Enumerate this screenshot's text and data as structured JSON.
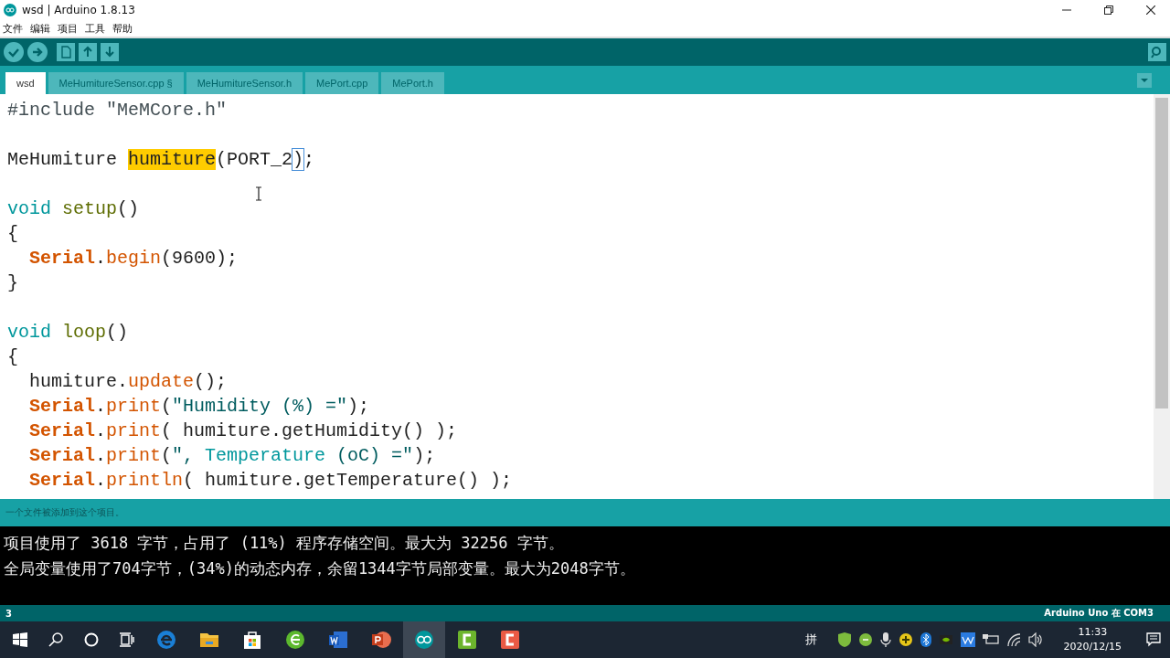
{
  "window": {
    "title": "wsd | Arduino 1.8.13"
  },
  "menu": [
    "文件",
    "编辑",
    "项目",
    "工具",
    "帮助"
  ],
  "tabs": [
    {
      "label": "wsd",
      "selected": true
    },
    {
      "label": "MeHumitureSensor.cpp §",
      "selected": false
    },
    {
      "label": "MeHumitureSensor.h",
      "selected": false
    },
    {
      "label": "MePort.cpp",
      "selected": false
    },
    {
      "label": "MePort.h",
      "selected": false
    }
  ],
  "code": [
    {
      "kind": "code",
      "indented": false,
      "segments": [
        {
          "t": "#include \"MeMCore.h\"",
          "kind": "directive"
        }
      ]
    },
    {
      "kind": "blank"
    },
    {
      "kind": "code",
      "indented": false,
      "segments": [
        {
          "t": "MeHumiture ",
          "kind": "plain"
        },
        {
          "t": "humiture",
          "kind": "highlight"
        },
        {
          "t": "(PORT_2",
          "kind": "plain"
        },
        {
          "t": ")",
          "kind": "bracket"
        },
        {
          "t": ";",
          "kind": "plain"
        }
      ]
    },
    {
      "kind": "blank"
    },
    {
      "kind": "code",
      "indented": false,
      "segments": [
        {
          "t": "void ",
          "kind": "type"
        },
        {
          "t": "setup",
          "kind": "func"
        },
        {
          "t": "()",
          "kind": "plain"
        }
      ]
    },
    {
      "kind": "code",
      "indented": false,
      "segments": [
        {
          "t": "{",
          "kind": "plain"
        }
      ]
    },
    {
      "kind": "code",
      "indented": true,
      "segments": [
        {
          "t": "Serial",
          "kind": "class"
        },
        {
          "t": ".",
          "kind": "plain"
        },
        {
          "t": "begin",
          "kind": "method"
        },
        {
          "t": "(9600);",
          "kind": "plain"
        }
      ]
    },
    {
      "kind": "code",
      "indented": false,
      "segments": [
        {
          "t": "}",
          "kind": "plain"
        }
      ]
    },
    {
      "kind": "blank"
    },
    {
      "kind": "code",
      "indented": false,
      "segments": [
        {
          "t": "void ",
          "kind": "type"
        },
        {
          "t": "loop",
          "kind": "func"
        },
        {
          "t": "()",
          "kind": "plain"
        }
      ]
    },
    {
      "kind": "code",
      "indented": false,
      "segments": [
        {
          "t": "{",
          "kind": "plain"
        }
      ]
    },
    {
      "kind": "code",
      "indented": true,
      "segments": [
        {
          "t": "humiture.",
          "kind": "plain"
        },
        {
          "t": "update",
          "kind": "method"
        },
        {
          "t": "();",
          "kind": "plain"
        }
      ]
    },
    {
      "kind": "code",
      "indented": true,
      "segments": [
        {
          "t": "Serial",
          "kind": "class"
        },
        {
          "t": ".",
          "kind": "plain"
        },
        {
          "t": "print",
          "kind": "method"
        },
        {
          "t": "(",
          "kind": "plain"
        },
        {
          "t": "\"Humidity (%) =\"",
          "kind": "string"
        },
        {
          "t": ");",
          "kind": "plain"
        }
      ]
    },
    {
      "kind": "code",
      "indented": true,
      "segments": [
        {
          "t": "Serial",
          "kind": "class"
        },
        {
          "t": ".",
          "kind": "plain"
        },
        {
          "t": "print",
          "kind": "method"
        },
        {
          "t": "( humiture.getHumidity() );",
          "kind": "plain"
        }
      ]
    },
    {
      "kind": "code",
      "indented": true,
      "segments": [
        {
          "t": "Serial",
          "kind": "class"
        },
        {
          "t": ".",
          "kind": "plain"
        },
        {
          "t": "print",
          "kind": "method"
        },
        {
          "t": "(",
          "kind": "plain"
        },
        {
          "t": "\", ",
          "kind": "string"
        },
        {
          "t": "Temperature",
          "kind": "keyword"
        },
        {
          "t": " (oC) =\"",
          "kind": "string"
        },
        {
          "t": ");",
          "kind": "plain"
        }
      ]
    },
    {
      "kind": "code",
      "indented": true,
      "segments": [
        {
          "t": "Serial",
          "kind": "class"
        },
        {
          "t": ".",
          "kind": "plain"
        },
        {
          "t": "println",
          "kind": "method"
        },
        {
          "t": "( humiture.getTemperature() );",
          "kind": "plain"
        }
      ]
    }
  ],
  "message": "一个文件被添加到这个项目。",
  "console": [
    "项目使用了 3618 字节，占用了 (11%) 程序存储空间。最大为 32256 字节。",
    "全局变量使用了704字节，(34%)的动态内存，余留1344字节局部变量。最大为2048字节。"
  ],
  "status_bar": {
    "line": "3",
    "board": "Arduino Uno 在 COM3"
  },
  "taskbar": {
    "ime": "拼",
    "time": "11:33",
    "date": "2020/12/15"
  }
}
